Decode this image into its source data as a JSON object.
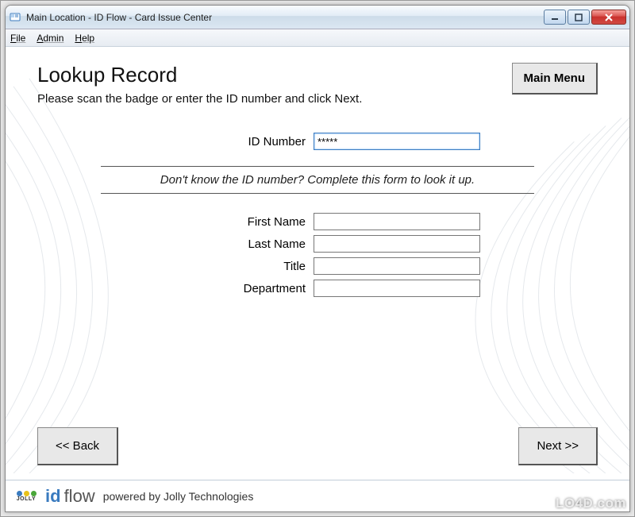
{
  "window": {
    "title": "Main Location - ID Flow - Card Issue Center"
  },
  "menu": {
    "file": "File",
    "admin": "Admin",
    "help": "Help"
  },
  "page": {
    "heading": "Lookup Record",
    "instruction": "Please scan the badge or enter the ID number and click Next.",
    "helper": "Don't know the ID number? Complete this form to look it up."
  },
  "fields": {
    "id_label": "ID Number",
    "id_value": "*****",
    "first_name_label": "First Name",
    "first_name_value": "",
    "last_name_label": "Last Name",
    "last_name_value": "",
    "title_label": "Title",
    "title_value": "",
    "department_label": "Department",
    "department_value": ""
  },
  "buttons": {
    "main_menu": "Main Menu",
    "back": "<< Back",
    "next": "Next >>"
  },
  "footer": {
    "jolly": "JOLLY",
    "brand_id": "id",
    "brand_flow": "flow",
    "brand_sub": "powered by Jolly Technologies"
  },
  "watermark": "LO4D.com"
}
